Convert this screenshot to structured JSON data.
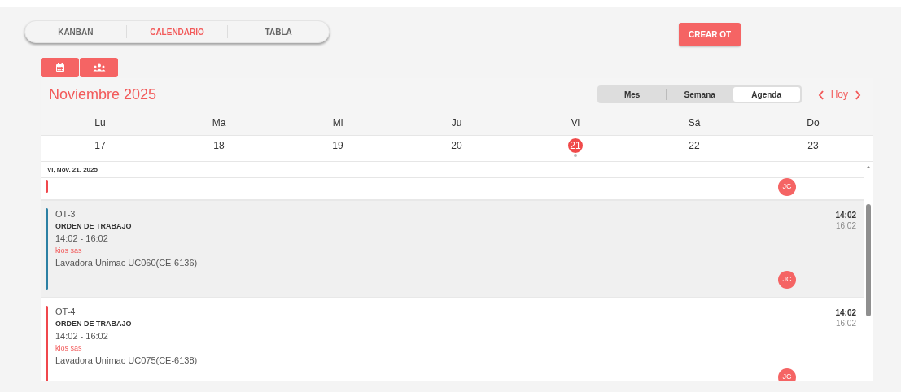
{
  "view_tabs": [
    {
      "label": "KANBAN",
      "selected": false
    },
    {
      "label": "CALENDARIO",
      "selected": true
    },
    {
      "label": "TABLA",
      "selected": false
    }
  ],
  "create_button": "CREAR OT",
  "mode_buttons": [
    {
      "kind": "calendar"
    },
    {
      "kind": "people"
    }
  ],
  "calendar": {
    "title": "Noviembre 2025",
    "views": [
      {
        "label": "Mes",
        "selected": false
      },
      {
        "label": "Semana",
        "selected": false
      },
      {
        "label": "Agenda",
        "selected": true
      }
    ],
    "today_button": "Hoy",
    "weekdays": [
      "Lu",
      "Ma",
      "Mi",
      "Ju",
      "Vi",
      "Sá",
      "Do"
    ],
    "days": [
      {
        "number": "17",
        "selected": false
      },
      {
        "number": "18",
        "selected": false
      },
      {
        "number": "19",
        "selected": false
      },
      {
        "number": "20",
        "selected": false
      },
      {
        "number": "21",
        "selected": true
      },
      {
        "number": "22",
        "selected": false
      },
      {
        "number": "23",
        "selected": false
      }
    ],
    "agenda_date": "Vi, Nov. 21. 2025",
    "events": [
      {
        "kind": "partial",
        "color": "#f0474c",
        "avatar": "JC",
        "selected": false
      },
      {
        "kind": "full",
        "color": "#2b7fa3",
        "selected": true,
        "code": "OT-3",
        "type": "ORDEN DE TRABAJO",
        "time_range": "14:02 - 16:02",
        "client": "kios sas",
        "equipment": "Lavadora Unimac UC060(CE-6136)",
        "start": "14:02",
        "end": "16:02",
        "avatar": "JC"
      },
      {
        "kind": "full",
        "color": "#f0474c",
        "selected": false,
        "code": "OT-4",
        "type": "ORDEN DE TRABAJO",
        "time_range": "14:02 - 16:02",
        "client": "kios sas",
        "equipment": "Lavadora Unimac UC075(CE-6138)",
        "start": "14:02",
        "end": "16:02",
        "avatar": "JC"
      }
    ]
  }
}
